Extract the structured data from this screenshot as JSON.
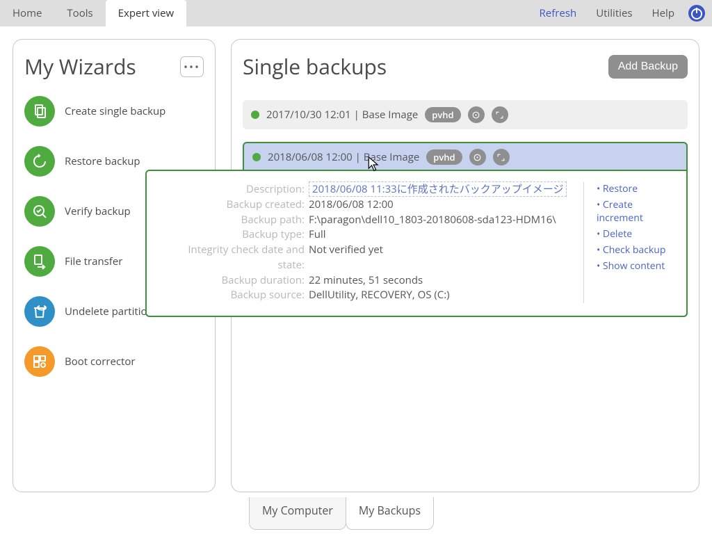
{
  "menu": {
    "home": "Home",
    "tools": "Tools",
    "expert": "Expert view",
    "refresh": "Refresh",
    "utilities": "Utilities",
    "help": "Help"
  },
  "sidebar": {
    "title": "My Wizards",
    "items": [
      {
        "label": "Create single backup"
      },
      {
        "label": "Restore backup"
      },
      {
        "label": "Verify backup"
      },
      {
        "label": "File transfer"
      },
      {
        "label": "Undelete partitions"
      },
      {
        "label": "Boot corrector"
      }
    ]
  },
  "main": {
    "title": "Single backups",
    "add_button": "Add Backup",
    "backups": [
      {
        "text": "2017/10/30 12:01 | Base Image",
        "badge": "pvhd"
      },
      {
        "text": "2018/06/08 12:00 | Base Image",
        "badge": "pvhd"
      }
    ]
  },
  "details": {
    "labels": {
      "description": "Description:",
      "created": "Backup created:",
      "path": "Backup path:",
      "type": "Backup type:",
      "integrity": "Integrity check date and state:",
      "duration": "Backup duration:",
      "source": "Backup source:"
    },
    "values": {
      "description": "2018/06/08 11:33に作成されたバックアップイメージ",
      "created": "2018/06/08 12:00",
      "path": "F:\\paragon\\dell10_1803-20180608-sda123-HDM16\\",
      "type": "Full",
      "integrity": "Not verified yet",
      "duration": "22 minutes, 51 seconds",
      "source": "DellUtility, RECOVERY, OS (C:)"
    },
    "actions": {
      "restore": "Restore",
      "increment": "Create increment",
      "delete": "Delete",
      "check": "Check backup",
      "show": "Show content"
    }
  },
  "bottom_tabs": {
    "computer": "My Computer",
    "backups": "My Backups"
  }
}
